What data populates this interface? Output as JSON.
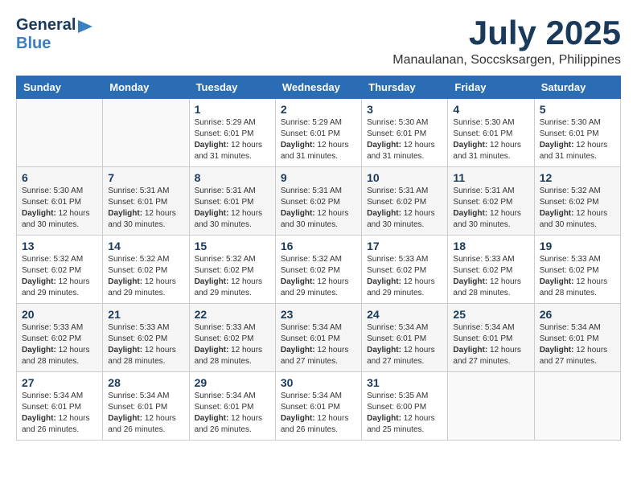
{
  "header": {
    "logo": {
      "line1": "General",
      "line2": "Blue"
    },
    "title": "July 2025",
    "location": "Manaulanan, Soccsksargen, Philippines"
  },
  "calendar": {
    "days_of_week": [
      "Sunday",
      "Monday",
      "Tuesday",
      "Wednesday",
      "Thursday",
      "Friday",
      "Saturday"
    ],
    "weeks": [
      [
        {
          "day": "",
          "info": ""
        },
        {
          "day": "",
          "info": ""
        },
        {
          "day": "1",
          "info": "Sunrise: 5:29 AM\nSunset: 6:01 PM\nDaylight: 12 hours and 31 minutes."
        },
        {
          "day": "2",
          "info": "Sunrise: 5:29 AM\nSunset: 6:01 PM\nDaylight: 12 hours and 31 minutes."
        },
        {
          "day": "3",
          "info": "Sunrise: 5:30 AM\nSunset: 6:01 PM\nDaylight: 12 hours and 31 minutes."
        },
        {
          "day": "4",
          "info": "Sunrise: 5:30 AM\nSunset: 6:01 PM\nDaylight: 12 hours and 31 minutes."
        },
        {
          "day": "5",
          "info": "Sunrise: 5:30 AM\nSunset: 6:01 PM\nDaylight: 12 hours and 31 minutes."
        }
      ],
      [
        {
          "day": "6",
          "info": "Sunrise: 5:30 AM\nSunset: 6:01 PM\nDaylight: 12 hours and 30 minutes."
        },
        {
          "day": "7",
          "info": "Sunrise: 5:31 AM\nSunset: 6:01 PM\nDaylight: 12 hours and 30 minutes."
        },
        {
          "day": "8",
          "info": "Sunrise: 5:31 AM\nSunset: 6:01 PM\nDaylight: 12 hours and 30 minutes."
        },
        {
          "day": "9",
          "info": "Sunrise: 5:31 AM\nSunset: 6:02 PM\nDaylight: 12 hours and 30 minutes."
        },
        {
          "day": "10",
          "info": "Sunrise: 5:31 AM\nSunset: 6:02 PM\nDaylight: 12 hours and 30 minutes."
        },
        {
          "day": "11",
          "info": "Sunrise: 5:31 AM\nSunset: 6:02 PM\nDaylight: 12 hours and 30 minutes."
        },
        {
          "day": "12",
          "info": "Sunrise: 5:32 AM\nSunset: 6:02 PM\nDaylight: 12 hours and 30 minutes."
        }
      ],
      [
        {
          "day": "13",
          "info": "Sunrise: 5:32 AM\nSunset: 6:02 PM\nDaylight: 12 hours and 29 minutes."
        },
        {
          "day": "14",
          "info": "Sunrise: 5:32 AM\nSunset: 6:02 PM\nDaylight: 12 hours and 29 minutes."
        },
        {
          "day": "15",
          "info": "Sunrise: 5:32 AM\nSunset: 6:02 PM\nDaylight: 12 hours and 29 minutes."
        },
        {
          "day": "16",
          "info": "Sunrise: 5:32 AM\nSunset: 6:02 PM\nDaylight: 12 hours and 29 minutes."
        },
        {
          "day": "17",
          "info": "Sunrise: 5:33 AM\nSunset: 6:02 PM\nDaylight: 12 hours and 29 minutes."
        },
        {
          "day": "18",
          "info": "Sunrise: 5:33 AM\nSunset: 6:02 PM\nDaylight: 12 hours and 28 minutes."
        },
        {
          "day": "19",
          "info": "Sunrise: 5:33 AM\nSunset: 6:02 PM\nDaylight: 12 hours and 28 minutes."
        }
      ],
      [
        {
          "day": "20",
          "info": "Sunrise: 5:33 AM\nSunset: 6:02 PM\nDaylight: 12 hours and 28 minutes."
        },
        {
          "day": "21",
          "info": "Sunrise: 5:33 AM\nSunset: 6:02 PM\nDaylight: 12 hours and 28 minutes."
        },
        {
          "day": "22",
          "info": "Sunrise: 5:33 AM\nSunset: 6:02 PM\nDaylight: 12 hours and 28 minutes."
        },
        {
          "day": "23",
          "info": "Sunrise: 5:34 AM\nSunset: 6:01 PM\nDaylight: 12 hours and 27 minutes."
        },
        {
          "day": "24",
          "info": "Sunrise: 5:34 AM\nSunset: 6:01 PM\nDaylight: 12 hours and 27 minutes."
        },
        {
          "day": "25",
          "info": "Sunrise: 5:34 AM\nSunset: 6:01 PM\nDaylight: 12 hours and 27 minutes."
        },
        {
          "day": "26",
          "info": "Sunrise: 5:34 AM\nSunset: 6:01 PM\nDaylight: 12 hours and 27 minutes."
        }
      ],
      [
        {
          "day": "27",
          "info": "Sunrise: 5:34 AM\nSunset: 6:01 PM\nDaylight: 12 hours and 26 minutes."
        },
        {
          "day": "28",
          "info": "Sunrise: 5:34 AM\nSunset: 6:01 PM\nDaylight: 12 hours and 26 minutes."
        },
        {
          "day": "29",
          "info": "Sunrise: 5:34 AM\nSunset: 6:01 PM\nDaylight: 12 hours and 26 minutes."
        },
        {
          "day": "30",
          "info": "Sunrise: 5:34 AM\nSunset: 6:01 PM\nDaylight: 12 hours and 26 minutes."
        },
        {
          "day": "31",
          "info": "Sunrise: 5:35 AM\nSunset: 6:00 PM\nDaylight: 12 hours and 25 minutes."
        },
        {
          "day": "",
          "info": ""
        },
        {
          "day": "",
          "info": ""
        }
      ]
    ]
  }
}
